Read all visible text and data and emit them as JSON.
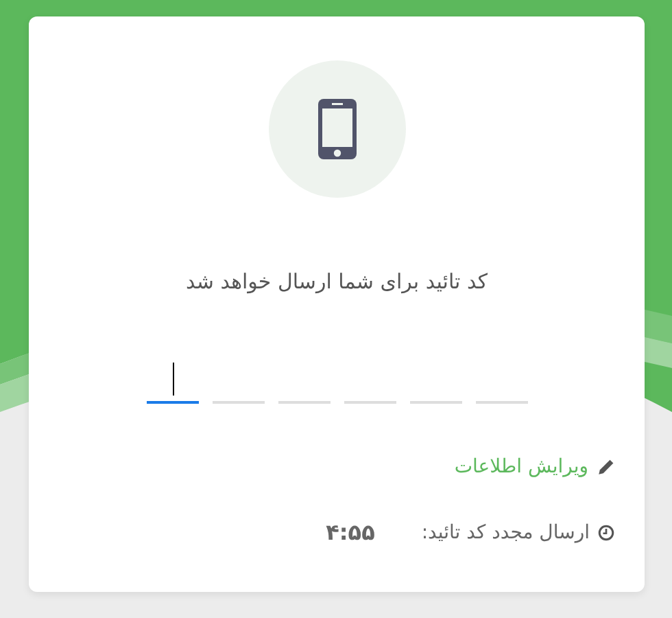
{
  "message": "کد تائید برای شما ارسال خواهد شد",
  "code_boxes": [
    {
      "focused": true
    },
    {
      "focused": false
    },
    {
      "focused": false
    },
    {
      "focused": false
    },
    {
      "focused": false
    },
    {
      "focused": false
    }
  ],
  "edit_link": "ویرایش اطلاعات",
  "resend": {
    "label": "ارسال مجدد کد تائید:",
    "timer": "۴:۵۵"
  }
}
